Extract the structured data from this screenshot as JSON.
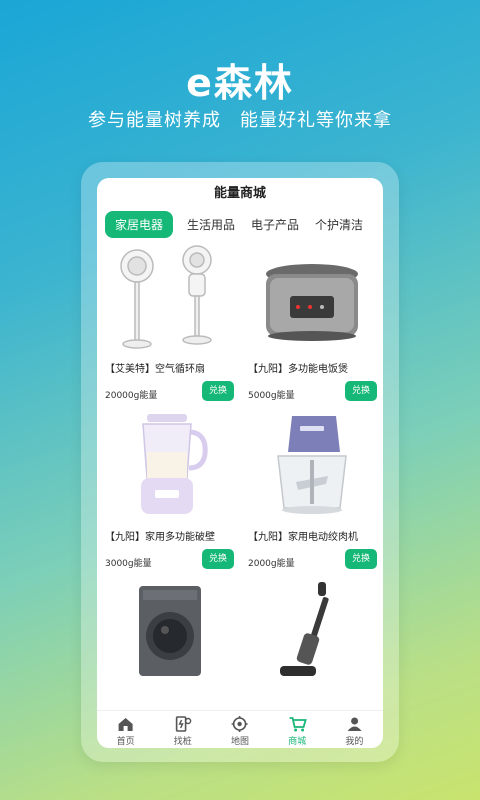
{
  "hero": {
    "title": "e森林",
    "subtitle": "参与能量树养成　能量好礼等你来拿"
  },
  "phone": {
    "title": "能量商城",
    "tabs": [
      "家居电器",
      "生活用品",
      "电子产品",
      "个护清洁"
    ],
    "products": [
      {
        "name": "【艾美特】空气循环扇",
        "points": "20000g能量",
        "button": "兑换",
        "icon": "fan-image"
      },
      {
        "name": "【九阳】多功能电饭煲",
        "points": "5000g能量",
        "button": "兑换",
        "icon": "rice-cooker-image"
      },
      {
        "name": "【九阳】家用多功能破壁",
        "points": "3000g能量",
        "button": "兑换",
        "icon": "blender-image"
      },
      {
        "name": "【九阳】家用电动绞肉机",
        "points": "2000g能量",
        "button": "兑换",
        "icon": "meat-grinder-image"
      },
      {
        "name": "",
        "points": "",
        "button": "",
        "icon": "washing-machine-image"
      },
      {
        "name": "",
        "points": "",
        "button": "",
        "icon": "floor-washer-image"
      }
    ],
    "nav": [
      {
        "label": "首页",
        "icon": "home-icon"
      },
      {
        "label": "找桩",
        "icon": "charger-icon"
      },
      {
        "label": "地图",
        "icon": "location-icon"
      },
      {
        "label": "商城",
        "icon": "cart-icon"
      },
      {
        "label": "我的",
        "icon": "person-icon"
      }
    ],
    "accent_color": "#16b877"
  }
}
